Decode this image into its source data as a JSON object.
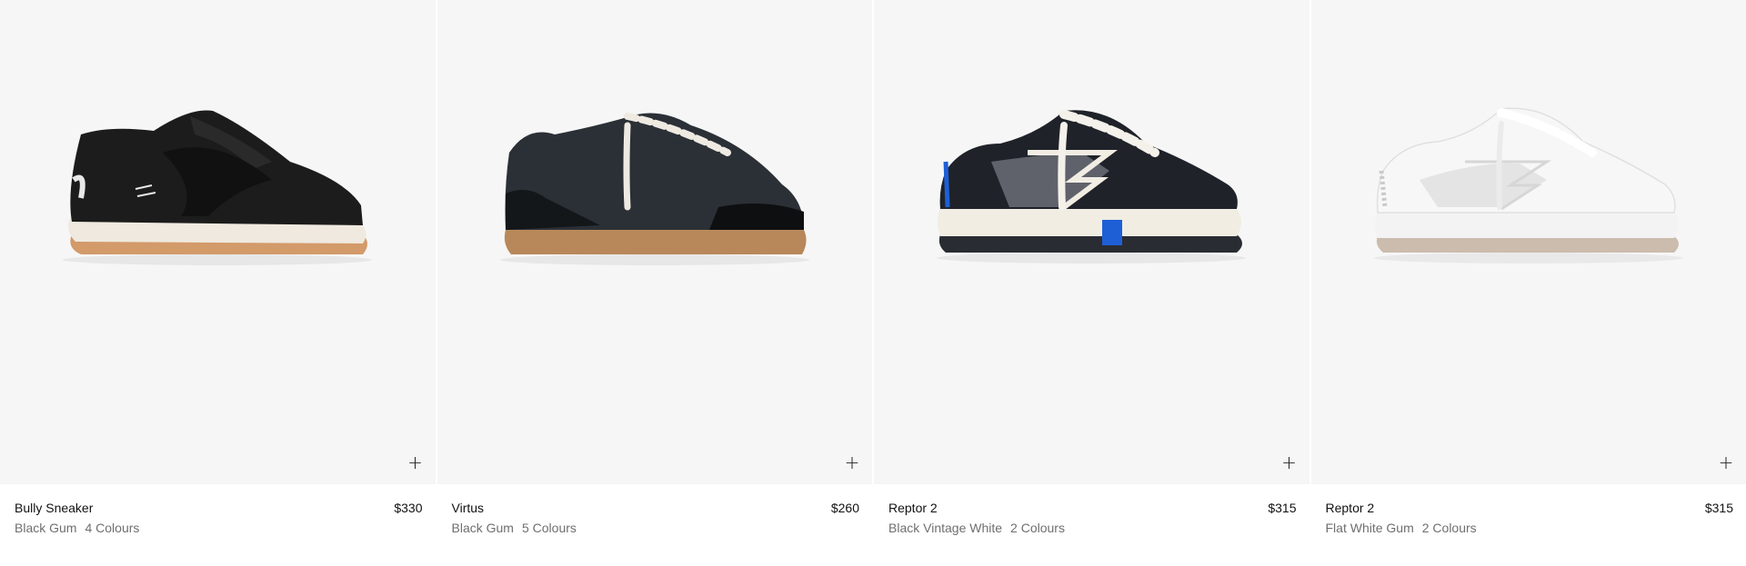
{
  "products": [
    {
      "name": "Bully Sneaker",
      "price": "$330",
      "colorway": "Black Gum",
      "colours": "4 Colours",
      "add_icon": "plus-icon",
      "palette": {
        "upper": "#1c1c1c",
        "upper_shade": "#2a2a2a",
        "midsole": "#efe9df",
        "outsole": "#d39a6a",
        "lace": "#151515",
        "accent": "#e8e8e8"
      }
    },
    {
      "name": "Virtus",
      "price": "$260",
      "colorway": "Black Gum",
      "colours": "5 Colours",
      "add_icon": "plus-icon",
      "palette": {
        "upper": "#2b3036",
        "upper_shade": "#14171a",
        "midsole": "#b8885a",
        "outsole": "#a87a4d",
        "lace": "#eeeae2",
        "accent": "#0e0f11"
      }
    },
    {
      "name": "Reptor 2",
      "price": "$315",
      "colorway": "Black Vintage White",
      "colours": "2 Colours",
      "add_icon": "plus-icon",
      "palette": {
        "upper": "#1f2229",
        "upper_shade": "#5f626a",
        "midsole": "#f1ede3",
        "outsole": "#2a2c33",
        "lace": "#f4f1ea",
        "accent": "#1f5fd6"
      }
    },
    {
      "name": "Reptor 2",
      "price": "$315",
      "colorway": "Flat White Gum",
      "colours": "2 Colours",
      "add_icon": "plus-icon",
      "palette": {
        "upper": "#f7f7f7",
        "upper_shade": "#e4e4e4",
        "midsole": "#f3f3f3",
        "outsole": "#cbbcae",
        "lace": "#ffffff",
        "accent": "#c9c9c9"
      }
    }
  ]
}
